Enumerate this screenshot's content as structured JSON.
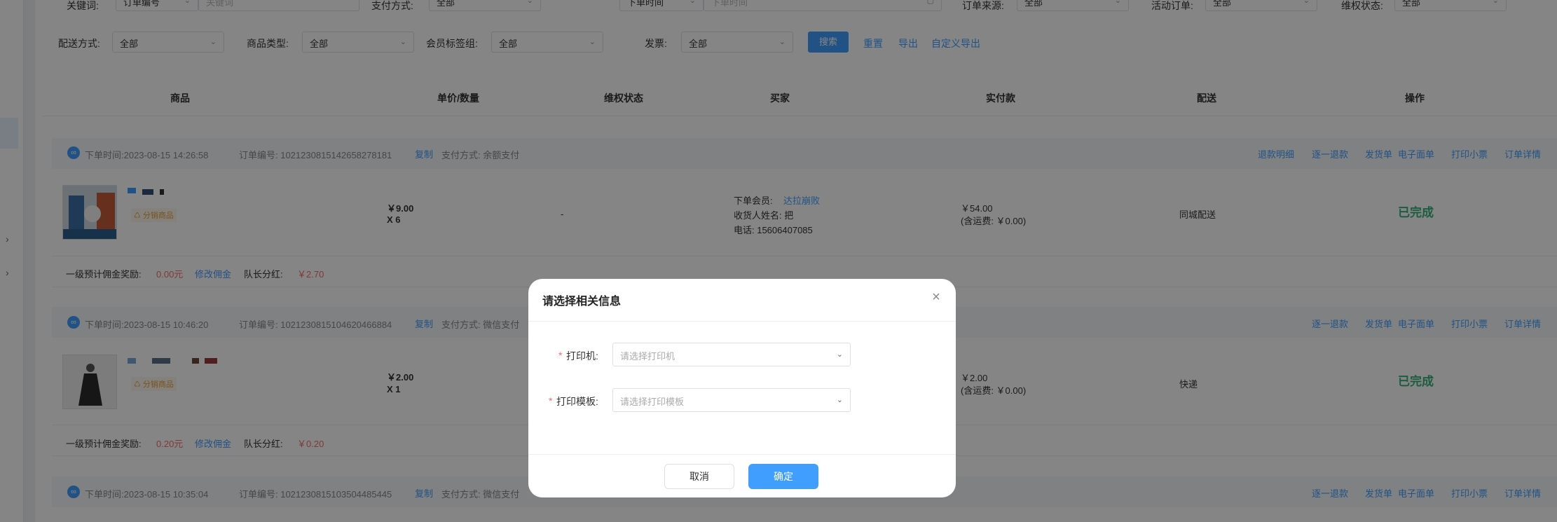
{
  "filters_row1": [
    {
      "label": "关键词:",
      "value": "订单编号",
      "placeholder": "关键词"
    },
    {
      "label": "支付方式:",
      "value": "全部"
    },
    {
      "label": "",
      "value": "下单时间",
      "placeholder": "下单时间"
    },
    {
      "label": "订单来源:",
      "value": "全部"
    },
    {
      "label": "活动订单:",
      "value": "全部"
    },
    {
      "label": "维权状态:",
      "value": "全部"
    }
  ],
  "filters_row2": [
    {
      "label": "配送方式:",
      "value": "全部"
    },
    {
      "label": "商品类型:",
      "value": "全部"
    },
    {
      "label": "会员标签组:",
      "value": "全部"
    },
    {
      "label": "发票:",
      "value": "全部"
    }
  ],
  "actions": {
    "search": "搜索",
    "reset": "重置",
    "export": "导出",
    "custom_export": "自定义导出"
  },
  "table_headers": [
    "商品",
    "单价/数量",
    "维权状态",
    "买家",
    "实付款",
    "配送",
    "操作"
  ],
  "orders": [
    {
      "time": "下单时间:2023-08-15 14:26:58",
      "order_no": "订单编号: 1021230815142658278181",
      "copy": "复制",
      "pay": "支付方式: 余额支付",
      "ops": [
        "退款明细",
        "逐一退款",
        "发货单",
        "电子面单",
        "打印小票",
        "订单详情"
      ],
      "tag": "分销商品",
      "unit_price": "￥9.00",
      "qty": "X 6",
      "rights": "-",
      "buyer_member_label": "下单会员:",
      "buyer_member": "达拉崩败",
      "receiver": "收货人姓名: 把",
      "phone": "电话: 15606407085",
      "paid": "￥54.00",
      "freight": "(含运费: ￥0.00)",
      "delivery": "同城配送",
      "status": "已完成",
      "commission_label": "一级预计佣金奖励:",
      "commission": "0.00元",
      "modify_commission": "修改佣金",
      "leader_label": "队长分红:",
      "leader": "￥2.70"
    },
    {
      "time": "下单时间:2023-08-15 10:46:20",
      "order_no": "订单编号: 1021230815104620466884",
      "copy": "复制",
      "pay": "支付方式: 微信支付",
      "ops": [
        "逐一退款",
        "发货单",
        "电子面单",
        "打印小票",
        "订单详情"
      ],
      "tag": "分销商品",
      "unit_price": "￥2.00",
      "qty": "X 1",
      "paid": "￥2.00",
      "freight": "(含运费: ￥0.00)",
      "delivery": "快递",
      "status": "已完成",
      "commission_label": "一级预计佣金奖励:",
      "commission": "0.20元",
      "modify_commission": "修改佣金",
      "leader_label": "队长分红:",
      "leader": "￥0.20"
    },
    {
      "time": "下单时间:2023-08-15 10:35:04",
      "order_no": "订单编号: 1021230815103504485445",
      "copy": "复制",
      "pay": "支付方式: 微信支付",
      "ops": [
        "逐一退款",
        "发货单",
        "电子面单",
        "打印小票",
        "订单详情"
      ]
    }
  ],
  "dialog": {
    "title": "请选择相关信息",
    "printer_label": "打印机:",
    "printer_placeholder": "请选择打印机",
    "template_label": "打印模板:",
    "template_placeholder": "请选择打印模板",
    "cancel": "取消",
    "confirm": "确定"
  },
  "colors": {
    "accent": "#409eff",
    "success": "#36b37e",
    "danger": "#f56c6c",
    "warning": "#e6a23c"
  }
}
